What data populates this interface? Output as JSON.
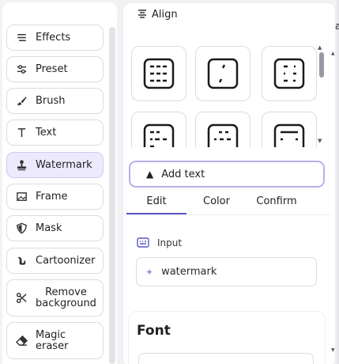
{
  "sidebar": {
    "items": [
      {
        "label": "Effects",
        "icon": "effects-lines-icon"
      },
      {
        "label": "Preset",
        "icon": "sliders-icon"
      },
      {
        "label": "Brush",
        "icon": "brush-icon"
      },
      {
        "label": "Text",
        "icon": "text-t-icon"
      },
      {
        "label": "Watermark",
        "icon": "stamp-icon",
        "active": true
      },
      {
        "label": "Frame",
        "icon": "frame-image-icon"
      },
      {
        "label": "Mask",
        "icon": "shield-icon"
      },
      {
        "label": "Cartoonizer",
        "icon": "cat-icon"
      },
      {
        "label": "Remove background",
        "icon": "scissors-icon"
      },
      {
        "label": "Magic eraser",
        "icon": "eraser-icon"
      }
    ]
  },
  "panel": {
    "align_label": "Align",
    "add_text_label": "Add text",
    "tabs": [
      {
        "label": "Edit",
        "active": true
      },
      {
        "label": "Color"
      },
      {
        "label": "Confirm"
      }
    ],
    "input_label": "Input",
    "input_value": "watermark",
    "font_heading": "Font",
    "edge_char": "a"
  },
  "colors": {
    "accent": "#5b55c9",
    "active_bg": "#eceafc",
    "active_border": "#b7b0ec"
  }
}
